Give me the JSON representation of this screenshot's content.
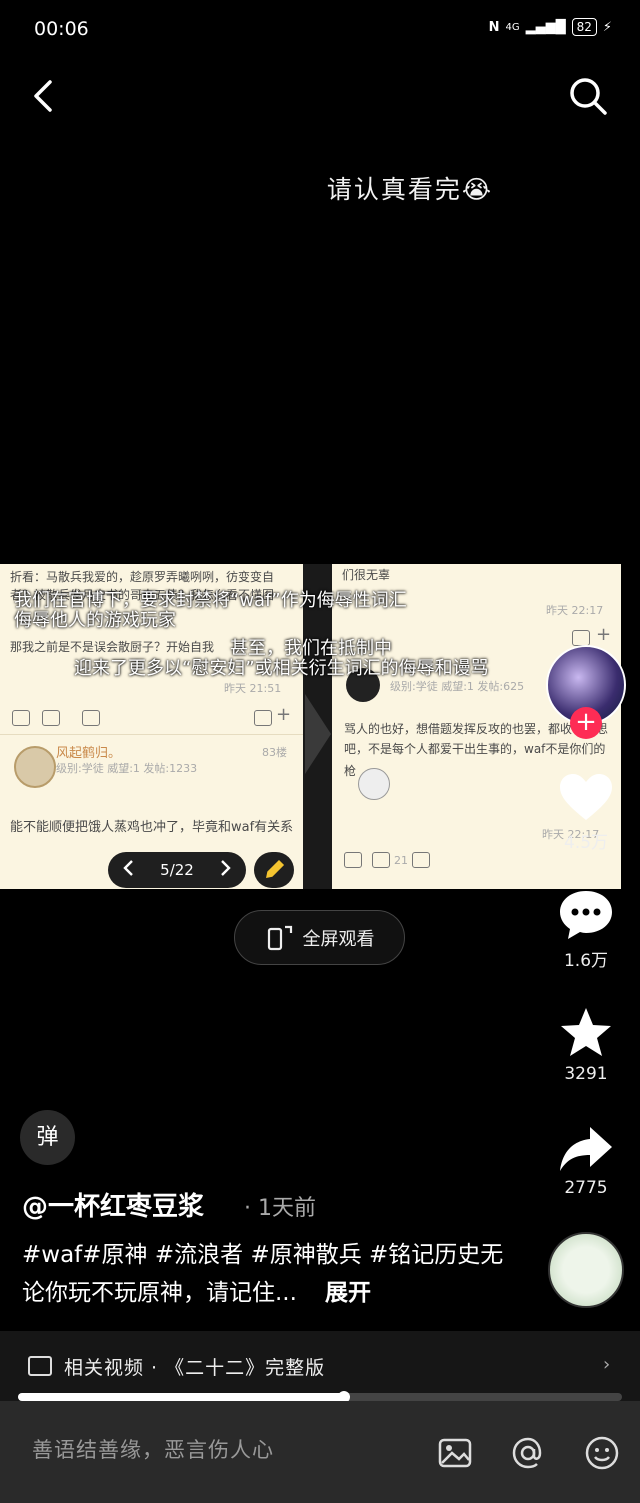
{
  "status": {
    "time": "00:06",
    "network": "4G",
    "battery": "82"
  },
  "caption": "请认真看完😭",
  "image_left": {
    "line1": "折看：马散兵我爱的，趁原罗弄曦咧咧，彷变变自",
    "line2": "者？被散兵发月史书的哥电五债？我怎么看不懂图",
    "line3": "那我之前是不是误会散厨子？开始自我",
    "time1": "昨天 21:51",
    "user_name": "风起鹤归。",
    "floor": "83楼",
    "user_meta": "级别:学徒  威望:1  发帖:1233",
    "reply": "能不能顺便把饿人蒸鸡也冲了，毕竟和waf有关系"
  },
  "image_right": {
    "top_line": "们很无辜",
    "time1": "昨天 22:17",
    "user_meta": "级别:学徒  威望:1  发帖:625",
    "body1": "骂人的也好，想借题发挥反攻的也罢，都收收心思",
    "body2": "吧，不是每个人都爱干出生事的，waf不是你们的",
    "body3": "枪",
    "time2": "昨天 22:17",
    "like_num": "21"
  },
  "overlay": {
    "line1": "我们在官博下，要求封禁将“waf”作为侮辱性词汇",
    "line2": "侮辱他人的游戏玩家",
    "line3": "甚至，我们在抵制中",
    "line4": "迎来了更多以“慰安妇”或相关衍生词汇的侮辱和谩骂"
  },
  "pager": {
    "label": "5/22"
  },
  "fullscreen": {
    "label": "全屏观看"
  },
  "actions": {
    "likes": "4.5万",
    "comments": "1.6万",
    "favorites": "3291",
    "shares": "2775"
  },
  "danmu_label": "弹",
  "post": {
    "author": "@一杯红枣豆浆",
    "time_ago": "· 1天前",
    "description": "#waf#原神 #流浪者 #原神散兵 #铭记历史无论你玩不玩原神，请记住...",
    "expand": "展开"
  },
  "related": {
    "text": "相关视频 · 《二十二》完整版"
  },
  "progress": {
    "fraction": 0.54
  },
  "comment_bar": {
    "placeholder": "善语结善缘，恶言伤人心"
  },
  "colors": {
    "accent": "#fe2c55",
    "card_bg": "#fbf5e1"
  }
}
